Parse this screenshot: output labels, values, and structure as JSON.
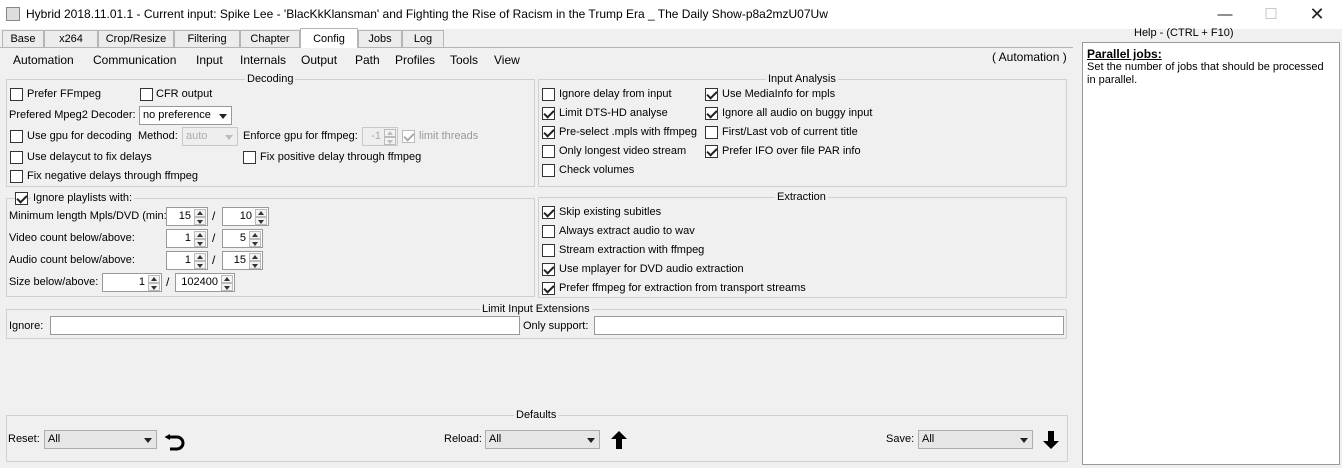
{
  "window": {
    "title": "Hybrid 2018.11.01.1 - Current input: Spike Lee - 'BlacKkKlansman' and Fighting the Rise of Racism in the Trump Era _ The Daily Show-p8a2mzU07Uw",
    "min_icon": "—",
    "max_icon": "☐",
    "close_icon": "✕"
  },
  "tabs": [
    "Base",
    "x264",
    "Crop/Resize",
    "Filtering",
    "Chapter",
    "Config",
    "Jobs",
    "Log"
  ],
  "menu": [
    "Automation",
    "Communication",
    "Input",
    "Internals",
    "Output",
    "Path",
    "Profiles",
    "Tools",
    "View"
  ],
  "automation_indicator": "( Automation )",
  "decoding": {
    "title": "Decoding",
    "prefer_ffmpeg": "Prefer FFmpeg",
    "cfr_output": "CFR output",
    "mpeg2_label": "Prefered Mpeg2 Decoder:",
    "mpeg2_value": "no preference",
    "use_gpu": "Use gpu for decoding",
    "method_label": "Method:",
    "method_value": "auto",
    "enforce_gpu_label": "Enforce gpu for ffmpeg:",
    "enforce_gpu_value": "-1",
    "limit_threads": "limit threads",
    "delaycut": "Use delaycut to fix delays",
    "fix_positive": "Fix positive delay through ffmpeg",
    "fix_negative": "Fix negative delays through ffmpeg"
  },
  "playlists": {
    "title": "Ignore playlists with:",
    "min_length_label": "Minimum length Mpls/DVD (min:)",
    "min_length_a": "15",
    "min_length_b": "10",
    "video_count_label": "Video count below/above:",
    "video_a": "1",
    "video_b": "5",
    "audio_count_label": "Audio count below/above:",
    "audio_a": "1",
    "audio_b": "15",
    "size_label": "Size below/above:",
    "size_a": "1",
    "size_b": "102400",
    "sep": "/"
  },
  "input_analysis": {
    "title": "Input Analysis",
    "ignore_delay": "Ignore delay from input",
    "limit_dts": "Limit DTS-HD analyse",
    "preselect_mpls": "Pre-select .mpls with ffmpeg",
    "only_longest": "Only longest video stream",
    "check_volumes": "Check volumes",
    "use_mediainfo": "Use MediaInfo for mpls",
    "ignore_audio": "Ignore all audio on buggy input",
    "first_last_vob": "First/Last vob of current title",
    "prefer_ifo": "Prefer IFO over file PAR info"
  },
  "extraction": {
    "title": "Extraction",
    "skip_subtitles": "Skip existing subitles",
    "always_wav": "Always extract audio to wav",
    "stream_ffmpeg": "Stream extraction with ffmpeg",
    "use_mplayer": "Use mplayer for DVD audio extraction",
    "prefer_ffmpeg_ts": "Prefer ffmpeg for extraction from transport streams"
  },
  "limit_input": {
    "title": "Limit Input Extensions",
    "ignore_label": "Ignore:",
    "ignore_value": "",
    "only_label": "Only support:",
    "only_value": ""
  },
  "defaults": {
    "title": "Defaults",
    "reset_label": "Reset:",
    "reset_value": "All",
    "reload_label": "Reload:",
    "reload_value": "All",
    "save_label": "Save:",
    "save_value": "All"
  },
  "help": {
    "title": "Help - (CTRL + F10)",
    "heading": "Parallel jobs:",
    "body": "Set the number of jobs that should be processed in parallel."
  }
}
